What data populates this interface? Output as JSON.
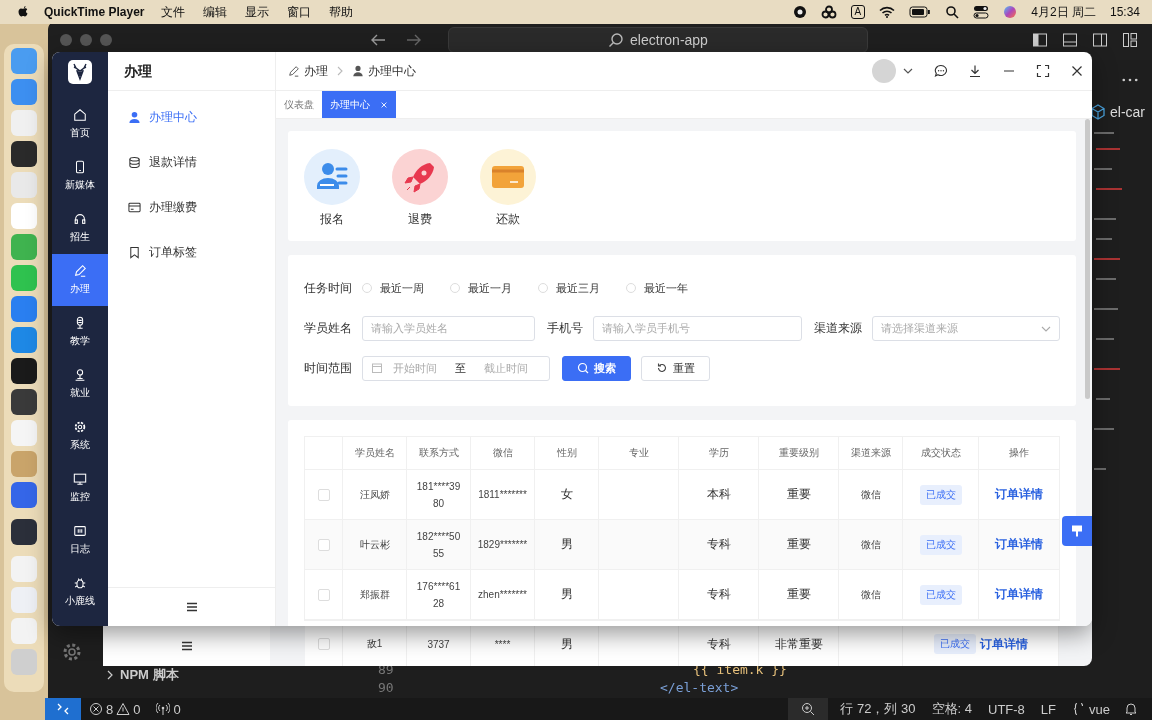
{
  "menubar": {
    "app": "QuickTime Player",
    "menus": [
      "文件",
      "编辑",
      "显示",
      "窗口",
      "帮助"
    ],
    "input_badge": "A",
    "date": "4月2日 周二",
    "time": "15:34"
  },
  "editor": {
    "search": "electron-app",
    "tab_fragment": "el-car",
    "sidebar_section": "NPM 脚本",
    "line_numbers": [
      "89",
      "90"
    ],
    "code_lines": [
      "{{ item.k }}",
      "</el-text>"
    ],
    "status": {
      "errors": "8",
      "warnings": "0",
      "ports": "0",
      "cursor": "行 72，列 30",
      "indent": "空格: 4",
      "encoding": "UTF-8",
      "eol": "LF",
      "language": "vue"
    }
  },
  "app": {
    "nav": [
      {
        "label": "首页",
        "kind": "home",
        "selected": false
      },
      {
        "label": "新媒体",
        "kind": "phone",
        "selected": false
      },
      {
        "label": "招生",
        "kind": "headset",
        "selected": false
      },
      {
        "label": "办理",
        "kind": "pen",
        "selected": true
      },
      {
        "label": "教学",
        "kind": "mic",
        "selected": false
      },
      {
        "label": "就业",
        "kind": "person",
        "selected": false
      },
      {
        "label": "系统",
        "kind": "gear",
        "selected": false
      },
      {
        "label": "监控",
        "kind": "monitor",
        "selected": false
      },
      {
        "label": "日志",
        "kind": "log",
        "selected": false
      },
      {
        "label": "小鹿线",
        "kind": "bug",
        "selected": false
      }
    ],
    "section_title": "办理",
    "submenu": [
      {
        "label": "办理中心",
        "kind": "user",
        "selected": true
      },
      {
        "label": "退款详情",
        "kind": "coins",
        "selected": false
      },
      {
        "label": "办理缴费",
        "kind": "card",
        "selected": false
      },
      {
        "label": "订单标签",
        "kind": "bookmark",
        "selected": false
      }
    ],
    "breadcrumb": [
      {
        "label": "办理",
        "kind": "pen"
      },
      {
        "label": "办理中心",
        "kind": "user"
      }
    ],
    "tabs": [
      {
        "label": "仪表盘",
        "selected": false,
        "closable": false
      },
      {
        "label": "办理中心",
        "selected": true,
        "closable": true
      }
    ],
    "quick_actions": [
      {
        "label": "报名",
        "kind": "enroll"
      },
      {
        "label": "退费",
        "kind": "refund"
      },
      {
        "label": "还款",
        "kind": "repay"
      }
    ],
    "filter": {
      "task_time": {
        "label": "任务时间",
        "options": [
          {
            "label": "最近一周",
            "selected": false
          },
          {
            "label": "最近一月",
            "selected": false
          },
          {
            "label": "最近三月",
            "selected": false
          },
          {
            "label": "最近一年",
            "selected": false
          }
        ]
      },
      "fields": [
        {
          "label": "学员姓名",
          "placeholder": "请输入学员姓名",
          "kind": "input"
        },
        {
          "label": "手机号",
          "placeholder": "请输入学员手机号",
          "kind": "input"
        },
        {
          "label": "渠道来源",
          "placeholder": "请选择渠道来源",
          "kind": "select"
        }
      ],
      "date_range": {
        "label": "时间范围",
        "start_placeholder": "开始时间",
        "separator": "至",
        "end_placeholder": "截止时间"
      },
      "search_button": "搜索",
      "reset_button": "重置"
    },
    "table": {
      "columns": [
        "学员姓名",
        "联系方式",
        "微信",
        "性别",
        "专业",
        "学历",
        "重要级别",
        "渠道来源",
        "成交状态",
        "操作"
      ],
      "rows": [
        {
          "checked": false,
          "name": "汪凤娇",
          "phone": "181****3980",
          "wechat": "1811*******",
          "gender": "女",
          "education": "本科",
          "level": "重要",
          "channel": "微信",
          "status": "已成交",
          "action": "订单详情"
        },
        {
          "checked": false,
          "name": "叶云彬",
          "phone": "182****5055",
          "wechat": "1829*******",
          "gender": "男",
          "education": "专科",
          "level": "重要",
          "channel": "微信",
          "status": "已成交",
          "action": "订单详情"
        },
        {
          "checked": false,
          "name": "郑振群",
          "phone": "176****6128",
          "wechat": "zhen*******",
          "gender": "男",
          "education": "专科",
          "level": "重要",
          "channel": "微信",
          "status": "已成交",
          "action": "订单详情"
        }
      ]
    }
  },
  "background_window_row": {
    "checked": false,
    "name": "敌1",
    "phone": "3737",
    "wechat": "****",
    "gender": "男",
    "education": "专科",
    "level": "非常重要",
    "status": "已成交",
    "action": "订单详情"
  }
}
